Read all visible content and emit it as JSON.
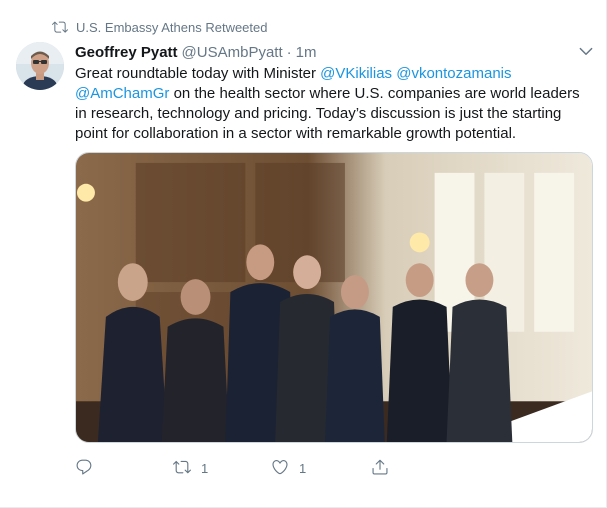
{
  "retweet_context": {
    "label": "U.S. Embassy Athens Retweeted",
    "icon": "retweet-icon"
  },
  "tweet": {
    "author_name": "Geoffrey Pyatt",
    "author_handle": "@USAmbPyatt",
    "separator": "·",
    "timestamp": "1m",
    "text_parts": {
      "p1": "Great roundtable today with Minister ",
      "m1": "@VKikilias",
      "p2": " ",
      "m2": "@vkontozamanis",
      "p3": " ",
      "m3": "@AmChamGr",
      "p4": " on the health sector where U.S. companies are world leaders in research, technology and pricing. Today’s discussion is just the starting point for collaboration in a sector with remarkable growth potential."
    },
    "media": {
      "kind": "photo",
      "description_icon": "photo-group-icon"
    }
  },
  "actions": {
    "reply": {
      "icon": "reply-icon",
      "count": ""
    },
    "retweet": {
      "icon": "retweet-icon",
      "count": "1"
    },
    "like": {
      "icon": "heart-icon",
      "count": "1"
    },
    "share": {
      "icon": "share-icon",
      "count": ""
    }
  },
  "colors": {
    "text": "#14171a",
    "secondary": "#657786",
    "link": "#1b95e0",
    "border": "#e6ecf0"
  }
}
